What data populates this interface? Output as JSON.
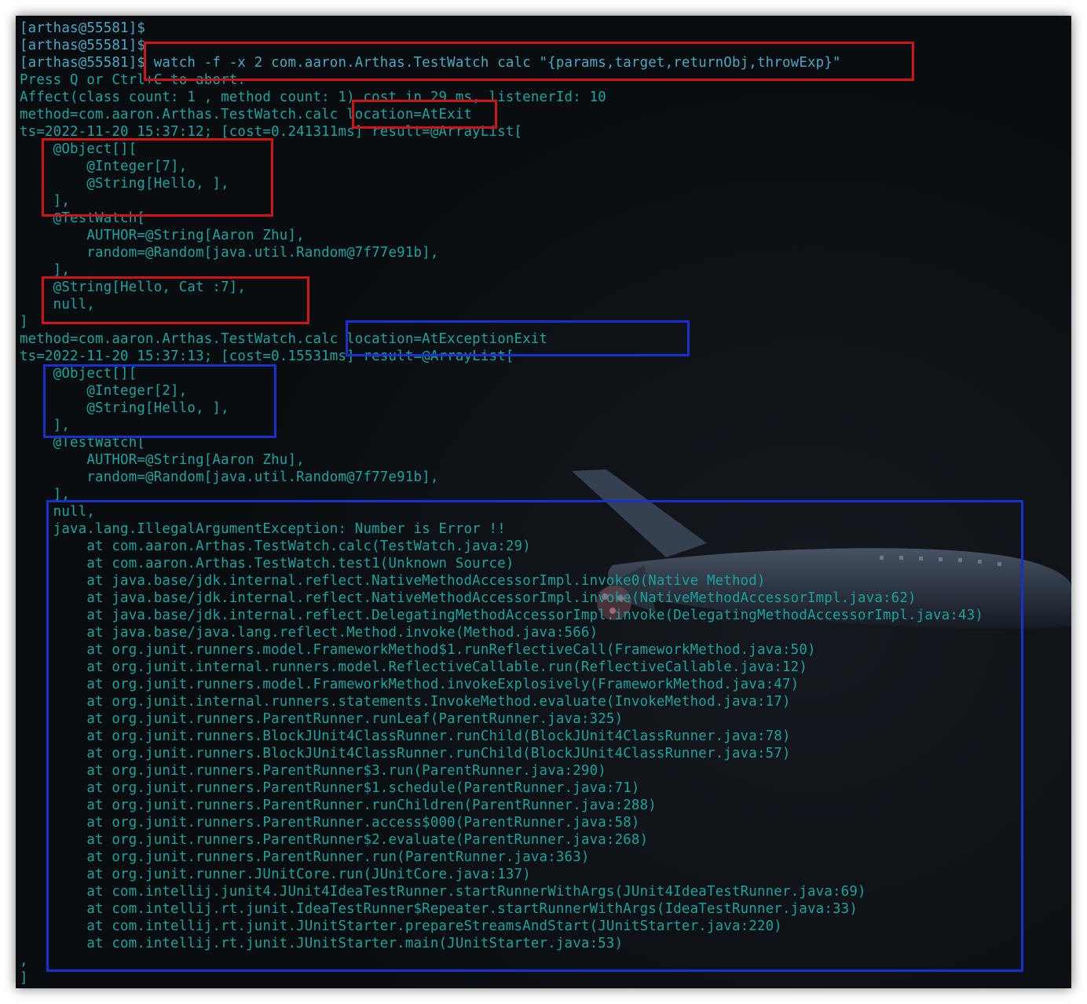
{
  "terminal": {
    "text_color": "#1ba3a1",
    "background": "#0a0d10",
    "highlight_colors": {
      "red": "#d01219",
      "blue": "#1830cf"
    },
    "lines": [
      {
        "kind": "prompt",
        "text": "[arthas@55581]$"
      },
      {
        "kind": "prompt",
        "text": "[arthas@55581]$"
      },
      {
        "kind": "prompt",
        "text": "[arthas@55581]$ watch -f -x 2 com.aaron.Arthas.TestWatch calc \"{params,target,returnObj,throwExp}\""
      },
      {
        "kind": "output",
        "text": "Press Q or Ctrl+C to abort."
      },
      {
        "kind": "output",
        "text": "Affect(class count: 1 , method count: 1) cost in 29 ms, listenerId: 10"
      },
      {
        "kind": "output",
        "text": "method=com.aaron.Arthas.TestWatch.calc location=AtExit"
      },
      {
        "kind": "output",
        "text": "ts=2022-11-20 15:37:12; [cost=0.241311ms] result=@ArrayList["
      },
      {
        "kind": "output",
        "text": "    @Object[]["
      },
      {
        "kind": "output",
        "text": "        @Integer[7],"
      },
      {
        "kind": "output",
        "text": "        @String[Hello, ],"
      },
      {
        "kind": "output",
        "text": "    ],"
      },
      {
        "kind": "output",
        "text": "    @TestWatch["
      },
      {
        "kind": "output",
        "text": "        AUTHOR=@String[Aaron Zhu],"
      },
      {
        "kind": "output",
        "text": "        random=@Random[java.util.Random@7f77e91b],"
      },
      {
        "kind": "output",
        "text": "    ],"
      },
      {
        "kind": "output",
        "text": "    @String[Hello, Cat :7],"
      },
      {
        "kind": "output",
        "text": "    null,"
      },
      {
        "kind": "output",
        "text": "]"
      },
      {
        "kind": "output",
        "text": "method=com.aaron.Arthas.TestWatch.calc location=AtExceptionExit"
      },
      {
        "kind": "output",
        "text": "ts=2022-11-20 15:37:13; [cost=0.15531ms] result=@ArrayList["
      },
      {
        "kind": "output",
        "text": "    @Object[]["
      },
      {
        "kind": "output",
        "text": "        @Integer[2],"
      },
      {
        "kind": "output",
        "text": "        @String[Hello, ],"
      },
      {
        "kind": "output",
        "text": "    ],"
      },
      {
        "kind": "output",
        "text": "    @TestWatch["
      },
      {
        "kind": "output",
        "text": "        AUTHOR=@String[Aaron Zhu],"
      },
      {
        "kind": "output",
        "text": "        random=@Random[java.util.Random@7f77e91b],"
      },
      {
        "kind": "output",
        "text": "    ],"
      },
      {
        "kind": "output",
        "text": "    null,"
      },
      {
        "kind": "output",
        "text": "    java.lang.IllegalArgumentException: Number is Error !!"
      },
      {
        "kind": "stack",
        "text": "        at com.aaron.Arthas.TestWatch.calc(TestWatch.java:29)"
      },
      {
        "kind": "stack",
        "text": "        at com.aaron.Arthas.TestWatch.test1(Unknown Source)"
      },
      {
        "kind": "stack",
        "text": "        at java.base/jdk.internal.reflect.NativeMethodAccessorImpl.invoke0(Native Method)"
      },
      {
        "kind": "stack",
        "text": "        at java.base/jdk.internal.reflect.NativeMethodAccessorImpl.invoke(NativeMethodAccessorImpl.java:62)"
      },
      {
        "kind": "stack",
        "text": "        at java.base/jdk.internal.reflect.DelegatingMethodAccessorImpl.invoke(DelegatingMethodAccessorImpl.java:43)"
      },
      {
        "kind": "stack",
        "text": "        at java.base/java.lang.reflect.Method.invoke(Method.java:566)"
      },
      {
        "kind": "stack",
        "text": "        at org.junit.runners.model.FrameworkMethod$1.runReflectiveCall(FrameworkMethod.java:50)"
      },
      {
        "kind": "stack",
        "text": "        at org.junit.internal.runners.model.ReflectiveCallable.run(ReflectiveCallable.java:12)"
      },
      {
        "kind": "stack",
        "text": "        at org.junit.runners.model.FrameworkMethod.invokeExplosively(FrameworkMethod.java:47)"
      },
      {
        "kind": "stack",
        "text": "        at org.junit.internal.runners.statements.InvokeMethod.evaluate(InvokeMethod.java:17)"
      },
      {
        "kind": "stack",
        "text": "        at org.junit.runners.ParentRunner.runLeaf(ParentRunner.java:325)"
      },
      {
        "kind": "stack",
        "text": "        at org.junit.runners.BlockJUnit4ClassRunner.runChild(BlockJUnit4ClassRunner.java:78)"
      },
      {
        "kind": "stack",
        "text": "        at org.junit.runners.BlockJUnit4ClassRunner.runChild(BlockJUnit4ClassRunner.java:57)"
      },
      {
        "kind": "stack",
        "text": "        at org.junit.runners.ParentRunner$3.run(ParentRunner.java:290)"
      },
      {
        "kind": "stack",
        "text": "        at org.junit.runners.ParentRunner$1.schedule(ParentRunner.java:71)"
      },
      {
        "kind": "stack",
        "text": "        at org.junit.runners.ParentRunner.runChildren(ParentRunner.java:288)"
      },
      {
        "kind": "stack",
        "text": "        at org.junit.runners.ParentRunner.access$000(ParentRunner.java:58)"
      },
      {
        "kind": "stack",
        "text": "        at org.junit.runners.ParentRunner$2.evaluate(ParentRunner.java:268)"
      },
      {
        "kind": "stack",
        "text": "        at org.junit.runners.ParentRunner.run(ParentRunner.java:363)"
      },
      {
        "kind": "stack",
        "text": "        at org.junit.runner.JUnitCore.run(JUnitCore.java:137)"
      },
      {
        "kind": "stack",
        "text": "        at com.intellij.junit4.JUnit4IdeaTestRunner.startRunnerWithArgs(JUnit4IdeaTestRunner.java:69)"
      },
      {
        "kind": "stack",
        "text": "        at com.intellij.rt.junit.IdeaTestRunner$Repeater.startRunnerWithArgs(IdeaTestRunner.java:33)"
      },
      {
        "kind": "stack",
        "text": "        at com.intellij.rt.junit.JUnitStarter.prepareStreamsAndStart(JUnitStarter.java:220)"
      },
      {
        "kind": "stack",
        "text": "        at com.intellij.rt.junit.JUnitStarter.main(JUnitStarter.java:53)"
      },
      {
        "kind": "output",
        "text": ","
      },
      {
        "kind": "output",
        "text": "]"
      }
    ]
  }
}
